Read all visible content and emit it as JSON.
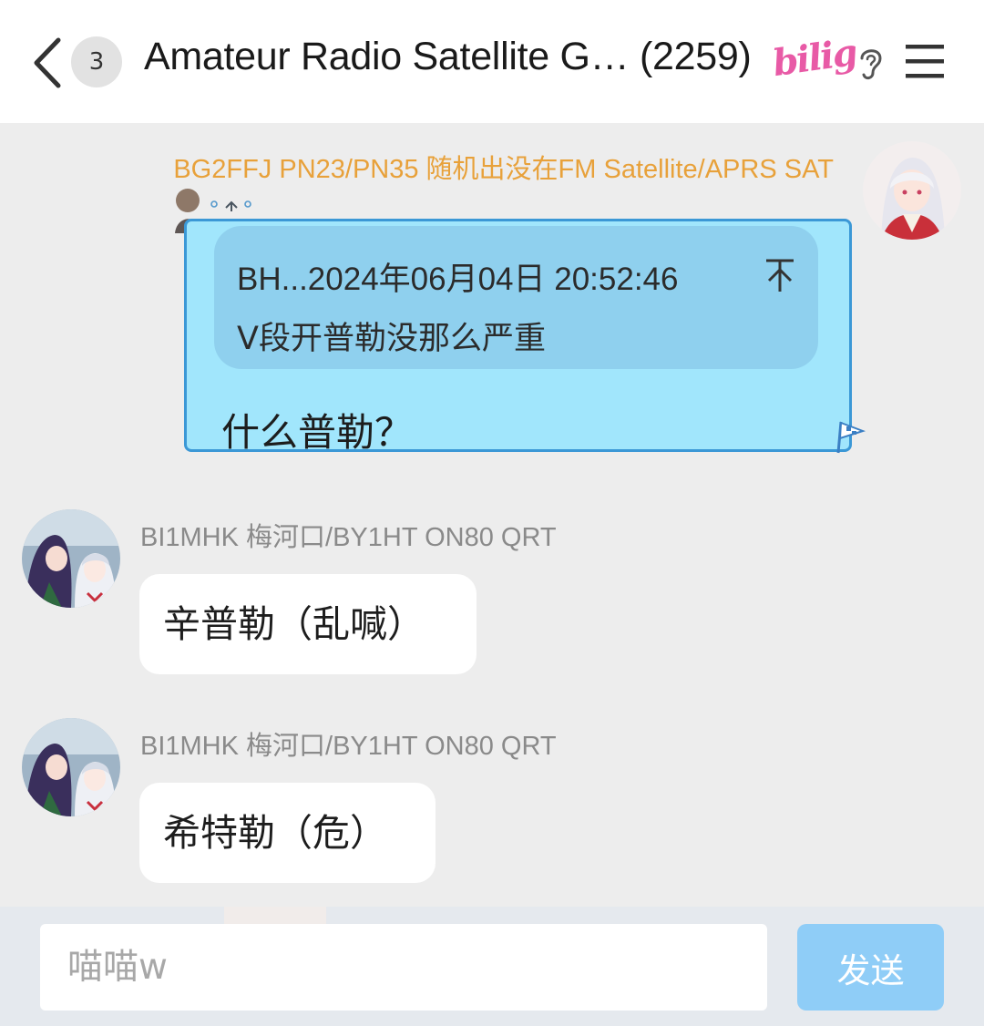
{
  "header": {
    "unread_count": "3",
    "title": "Amateur Radio Satellite G… (2259)",
    "badge_text": "bilig"
  },
  "messages": [
    {
      "sender": "BG2FFJ PN23/PN35 随机出没在FM Satellite/APRS SAT",
      "is_self": true,
      "quote": {
        "meta": "BH...2024年06月04日 20:52:46",
        "text": "V段开普勒没那么严重"
      },
      "text": "什么普勒？"
    },
    {
      "sender": "BI1MHK 梅河口/BY1HT ON80 QRT",
      "is_self": false,
      "text": "辛普勒（乱喊）"
    },
    {
      "sender": "BI1MHK 梅河口/BY1HT ON80 QRT",
      "is_self": false,
      "text": "希特勒（危）"
    }
  ],
  "composer": {
    "placeholder": "喵喵w",
    "send_label": "发送"
  },
  "colors": {
    "self_name": "#e8a13a",
    "self_bubble": "#a1e6fc",
    "self_bubble_border": "#3b98d6",
    "quote_bg": "#8fd0ee",
    "send_button": "#8fcdf7",
    "background": "#ededed"
  },
  "icons": [
    "back-arrow-icon",
    "ear-icon",
    "menu-icon",
    "jump-to-quote-icon",
    "flag-icon"
  ]
}
